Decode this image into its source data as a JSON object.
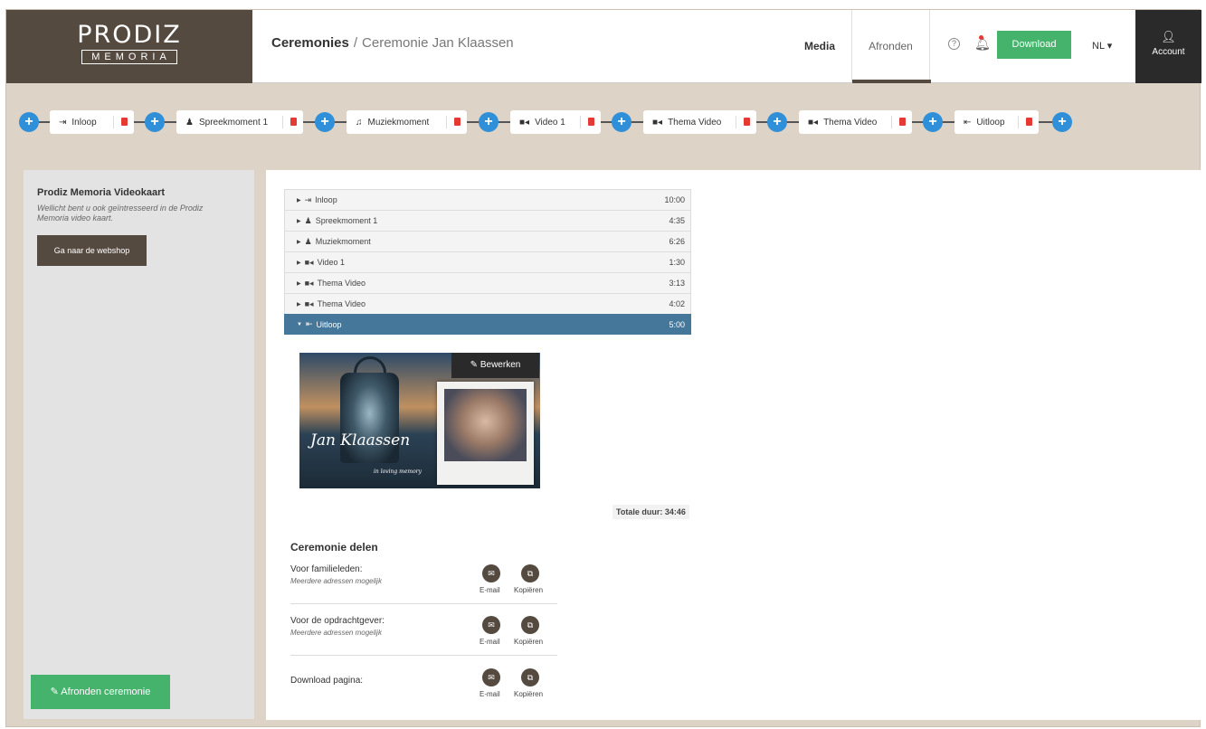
{
  "header": {
    "logo_top": "PRODIZ",
    "logo_bottom": "MEMORIA",
    "breadcrumb_root": "Ceremonies",
    "breadcrumb_sep": "/",
    "breadcrumb_current": "Ceremonie Jan Klaassen",
    "nav_media": "Media",
    "nav_afronden": "Afronden",
    "help_glyph": "?",
    "download_label": "Download",
    "lang_label": "NL ▾",
    "account_label": "Account"
  },
  "timeline": {
    "segments": [
      {
        "icon": "sign-in-icon",
        "glyph": "⇥",
        "label": "Inloop"
      },
      {
        "icon": "user-icon",
        "glyph": "♟",
        "label": "Spreekmoment 1"
      },
      {
        "icon": "music-icon",
        "glyph": "♫",
        "label": "Muziekmoment"
      },
      {
        "icon": "video-icon",
        "glyph": "■◂",
        "label": "Video 1"
      },
      {
        "icon": "video-icon",
        "glyph": "■◂",
        "label": "Thema Video"
      },
      {
        "icon": "video-icon",
        "glyph": "■◂",
        "label": "Thema Video"
      },
      {
        "icon": "sign-out-icon",
        "glyph": "⇤",
        "label": "Uitloop"
      }
    ]
  },
  "promo": {
    "title": "Prodiz Memoria Videokaart",
    "text": "Wellicht bent u ook geïntresseerd in de Prodiz Memoria video kaart.",
    "button": "Ga naar de webshop"
  },
  "finish_button": "Afronden ceremonie",
  "accordion": [
    {
      "glyph": "⇥",
      "label": "Inloop",
      "duration": "10:00"
    },
    {
      "glyph": "♟",
      "label": "Spreekmoment 1",
      "duration": "4:35"
    },
    {
      "glyph": "♟",
      "label": "Muziekmoment",
      "duration": "6:26"
    },
    {
      "glyph": "■◂",
      "label": "Video 1",
      "duration": "1:30"
    },
    {
      "glyph": "■◂",
      "label": "Thema Video",
      "duration": "3:13"
    },
    {
      "glyph": "■◂",
      "label": "Thema Video",
      "duration": "4:02"
    },
    {
      "glyph": "⇤",
      "label": "Uitloop",
      "duration": "5:00"
    }
  ],
  "preview": {
    "name_text": "Jan Klaassen",
    "subtitle_text": "in loving memory",
    "edit_label": "Bewerken"
  },
  "total": "Totale duur: 34:46",
  "share": {
    "title": "Ceremonie delen",
    "email_label": "E-mail",
    "copy_label": "Kopiëren",
    "rows": [
      {
        "label": "Voor familieleden:",
        "sub": "Meerdere adressen mogelijk"
      },
      {
        "label": "Voor de opdrachtgever:",
        "sub": "Meerdere adressen mogelijk"
      },
      {
        "label": "Download pagina:",
        "sub": ""
      }
    ]
  },
  "colors": {
    "brand_brown": "#554a40",
    "accent_green": "#45b36b",
    "accent_blue": "#2f8fd8",
    "active_row": "#44779a",
    "trash_red": "#e53935"
  }
}
